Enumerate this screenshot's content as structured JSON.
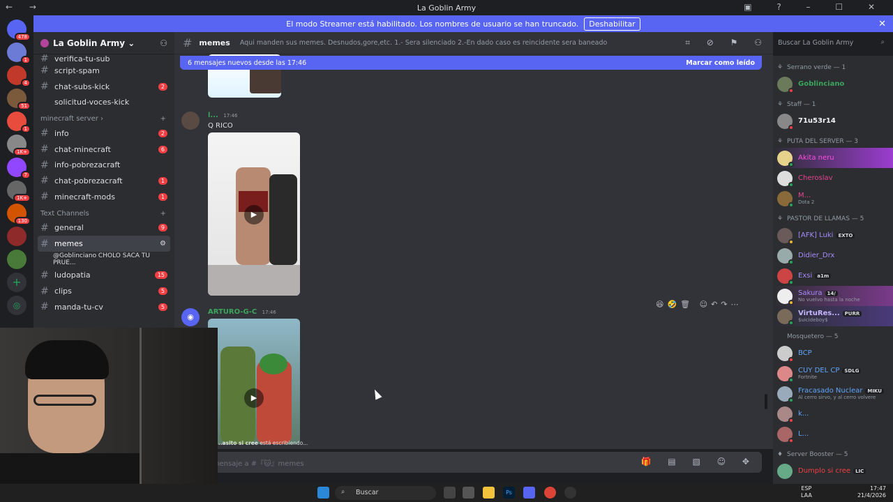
{
  "window": {
    "title": "La Goblin Army"
  },
  "notice": {
    "text": "El modo Streamer está habilitado. Los nombres de usuario se han truncado.",
    "button": "Deshabilitar"
  },
  "rail": {
    "badges": [
      "478",
      "1",
      "4",
      "51",
      "1",
      "1K+",
      "7",
      "1K+",
      "130"
    ]
  },
  "server": {
    "name": "La Goblin Army"
  },
  "channels": {
    "items": [
      {
        "label": "verifica-tu-sub",
        "badge": ""
      },
      {
        "label": "script-spam",
        "badge": ""
      },
      {
        "label": "chat-subs-kick",
        "badge": "2"
      },
      {
        "label": "solicitud-voces-kick",
        "badge": ""
      }
    ],
    "cat_minecraft": "minecraft server",
    "minecraft": [
      {
        "label": "info",
        "badge": "2"
      },
      {
        "label": "chat-minecraft",
        "badge": "6"
      },
      {
        "label": "info-pobrezacraft",
        "badge": ""
      },
      {
        "label": "chat-pobrezacraft",
        "badge": "1"
      },
      {
        "label": "minecraft-mods",
        "badge": "1"
      }
    ],
    "cat_text": "Text Channels",
    "text": [
      {
        "label": "general",
        "badge": "9"
      },
      {
        "label": "memes",
        "badge": ""
      },
      {
        "label": "@Goblinciano CHOLO SACA TU PRUE...",
        "badge": ""
      },
      {
        "label": "ludopatia",
        "badge": "15"
      },
      {
        "label": "clips",
        "badge": "5"
      },
      {
        "label": "manda-tu-cv",
        "badge": "5"
      }
    ]
  },
  "header": {
    "channel": "memes",
    "topic": "Aqui manden sus memes. Desnudos,gore,etc. 1.- Sera silenciado 2.-En dado caso es reincidente sera baneado",
    "search_placeholder": "Buscar La Goblin Army"
  },
  "newbar": {
    "text": "6 mensajes nuevos desde las 17:46",
    "mark": "Marcar como leído"
  },
  "messages": [
    {
      "author": "l...",
      "time": "17:46",
      "text": "Q RICO",
      "author_color": "#3ba55c"
    },
    {
      "author": "ARTURO-G-C",
      "time": "17:46",
      "text": "",
      "author_color": "#3ba55c"
    }
  ],
  "typing": {
    "name": "...asito si cree",
    "text": "está escribiendo..."
  },
  "composer": {
    "placeholder": "Enviar mensaje a #『🐱』memes"
  },
  "members": [
    {
      "category": "Serrano verde — 1",
      "items": [
        {
          "name": "Goblinciano",
          "color": "#3ba55c",
          "sub": "",
          "tag": ""
        }
      ]
    },
    {
      "category": "Staff — 1",
      "items": [
        {
          "name": "71u53r14",
          "color": "#f2f3f5",
          "sub": "",
          "tag": ""
        }
      ]
    },
    {
      "category": "PUTA DEL SERVER — 3",
      "items": [
        {
          "name": "Akita neru",
          "color": "#ff4de1",
          "sub": "",
          "tag": ""
        },
        {
          "name": "Cheroslav",
          "color": "#e84393",
          "sub": "",
          "tag": ""
        },
        {
          "name": "M...",
          "color": "#e84393",
          "sub": "Dota 2",
          "tag": ""
        }
      ]
    },
    {
      "category": "PASTOR DE LLAMAS — 5",
      "items": [
        {
          "name": "[AFK] Luki",
          "color": "#a78bfa",
          "sub": "",
          "tag": "EXTO"
        },
        {
          "name": "Didier_Drx",
          "color": "#a78bfa",
          "sub": "",
          "tag": ""
        },
        {
          "name": "Exsi",
          "color": "#a78bfa",
          "sub": "",
          "tag": "a1m"
        },
        {
          "name": "Sakura",
          "color": "#a78bfa",
          "sub": "No vuelvo hasta la noche",
          "tag": "14/"
        },
        {
          "name": "VirtuRes...",
          "color": "#c4b5fd",
          "sub": "$uicideboy$",
          "tag": "PURR"
        }
      ]
    },
    {
      "category": "Mosquetero — 5",
      "items": [
        {
          "name": "BCP",
          "color": "#60a5fa",
          "sub": "",
          "tag": ""
        },
        {
          "name": "CUY DEL CP",
          "color": "#60a5fa",
          "sub": "Fortnite",
          "tag": "SDLG"
        },
        {
          "name": "Fracasado Nuclear",
          "color": "#60a5fa",
          "sub": "Al cerro sirvo, y al cerro volvere",
          "tag": "MIKU"
        },
        {
          "name": "k...",
          "color": "#60a5fa",
          "sub": "",
          "tag": ""
        },
        {
          "name": "L...",
          "color": "#60a5fa",
          "sub": "",
          "tag": ""
        }
      ]
    },
    {
      "category": "Server Booster — 5",
      "items": [
        {
          "name": "Dumplo si cree",
          "color": "#f23f43",
          "sub": "",
          "tag": "LIC"
        }
      ]
    }
  ],
  "taskbar": {
    "search": "Buscar",
    "lang1": "ESP",
    "lang2": "LAA",
    "time": "17:47",
    "date": "21/4/2026"
  }
}
